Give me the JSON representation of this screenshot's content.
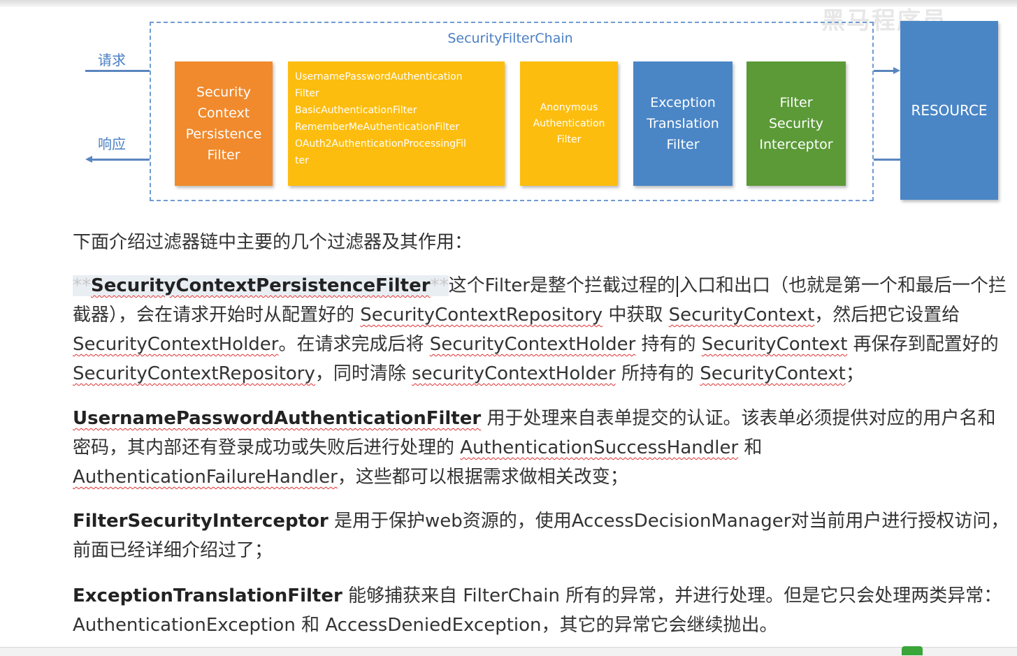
{
  "watermark": "黑马程序员",
  "diagram": {
    "chain_title": "SecurityFilterChain",
    "request_label": "请求",
    "response_label": "响应",
    "filters": [
      {
        "label": "Security\nContext\nPersistence\nFilter",
        "color": "#f08a2c"
      },
      {
        "label": "UsernamePasswordAuthentication\nFilter\nBasicAuthenticationFilter\nRememberMeAuthenticationFilter\nOAuth2AuthenticationProcessingFil\nter",
        "color": "#fdbd0f"
      },
      {
        "label": "Anonymous\nAuthentication\nFilter",
        "color": "#fdbd0f"
      },
      {
        "label": "Exception\nTranslation\nFilter",
        "color": "#4a86c6"
      },
      {
        "label": "Filter\nSecurity\nInterceptor",
        "color": "#5b9a37"
      }
    ],
    "resource_label": "RESOURCE"
  },
  "content": {
    "intro": "下面介绍过滤器链中主要的几个过滤器及其作用：",
    "p1": {
      "stars_open": "**",
      "name": "SecurityContextPersistenceFilter",
      "stars_close": "**",
      "t1": "这个Filter是整个拦截过程的",
      "t2": "入口和出口（也就是第一个和最后一个拦截器），会在请求开始时从配置好的 ",
      "c1": "SecurityContextRepository",
      "t3": " 中获取 ",
      "c2": "SecurityContext",
      "t4": "，然后把它设置给 ",
      "c3": "SecurityContextHolder",
      "t5": "。在请求完成后将 ",
      "c4": "SecurityContextHolder",
      "t6": " 持有的 ",
      "c5": "SecurityContext",
      "t7": " 再保存到配置好的 ",
      "c6": "SecurityContextRepository",
      "t8": "，同时清除 ",
      "c7": "securityContextHolder",
      "t9": " 所持有的 ",
      "c8": "SecurityContext",
      "t10": "；"
    },
    "p2": {
      "name": "UsernamePasswordAuthenticationFilter",
      "t1": " 用于处理来自表单提交的认证。该表单必须提供对应的用户名和密码，其内部还有登录成功或失败后进行处理的 ",
      "c1": "AuthenticationSuccessHandler",
      "t2": " 和 ",
      "c2": "AuthenticationFailureHandler",
      "t3": "，这些都可以根据需求做相关改变；"
    },
    "p3": {
      "name": "FilterSecurityInterceptor",
      "t1": " 是用于保护web资源的，使用AccessDecisionManager对当前用户进行授权访问，前面已经详细介绍过了；"
    },
    "p4": {
      "name": "ExceptionTranslationFilter",
      "t1": " 能够捕获来自 FilterChain 所有的异常，并进行处理。但是它只会处理两类异常：AuthenticationException 和 AccessDeniedException，其它的异常它会继续抛出。"
    }
  }
}
